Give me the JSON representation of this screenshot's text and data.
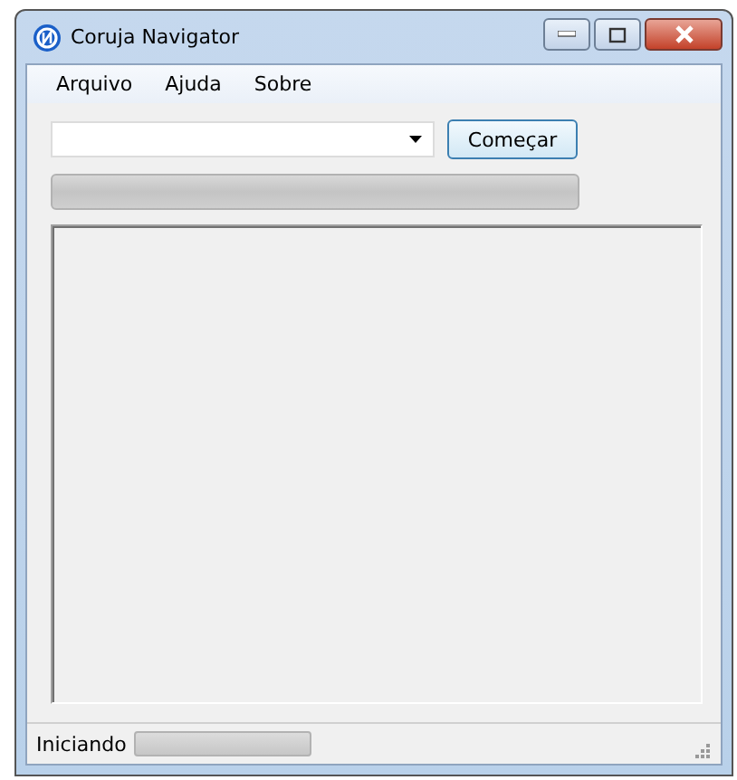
{
  "window": {
    "title": "Coruja Navigator"
  },
  "menu": [
    "Arquivo",
    "Ajuda",
    "Sobre"
  ],
  "start_button": {
    "label": "Começar"
  },
  "progress": {
    "level": 0
  },
  "status_bar": {
    "text": "Iniciando",
    "progress": {
      "level": 0
    }
  }
}
